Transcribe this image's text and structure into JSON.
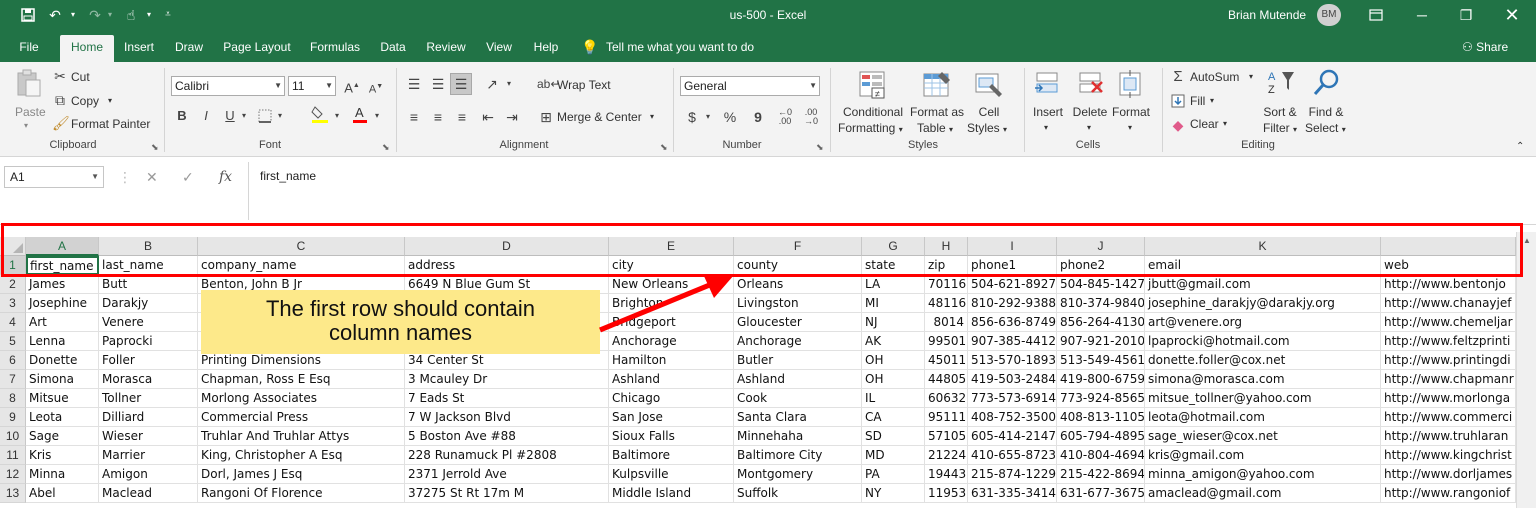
{
  "window": {
    "title": "us-500  -  Excel",
    "user": "Brian Mutende",
    "initials": "BM"
  },
  "tabs": [
    "File",
    "Home",
    "Insert",
    "Draw",
    "Page Layout",
    "Formulas",
    "Data",
    "Review",
    "View",
    "Help"
  ],
  "tell_me": "Tell me what you want to do",
  "share": "Share",
  "ribbon": {
    "clipboard": {
      "paste": "Paste",
      "cut": "Cut",
      "copy": "Copy",
      "format_painter": "Format Painter",
      "label": "Clipboard"
    },
    "font": {
      "name": "Calibri",
      "size": "11",
      "label": "Font",
      "bold": "B",
      "italic": "I",
      "underline": "U",
      "grow": "A",
      "shrink": "A"
    },
    "alignment": {
      "wrap_text": "Wrap Text",
      "merge_center": "Merge & Center",
      "label": "Alignment"
    },
    "number": {
      "format": "General",
      "currency": "$",
      "percent": "%",
      "comma": "9",
      "label": "Number"
    },
    "styles": {
      "conditional": "Conditional",
      "formatting": "Formatting",
      "format_as": "Format as",
      "table": "Table",
      "cell": "Cell",
      "styles": "Styles",
      "label": "Styles"
    },
    "cells": {
      "insert": "Insert",
      "delete": "Delete",
      "format": "Format",
      "label": "Cells"
    },
    "editing": {
      "autosum": "AutoSum",
      "fill": "Fill",
      "clear": "Clear",
      "sort": "Sort &",
      "filter": "Filter",
      "find": "Find &",
      "select": "Select",
      "label": "Editing"
    }
  },
  "formula_bar": {
    "name_box": "A1",
    "fx": "fx",
    "content": "first_name"
  },
  "columns": [
    "A",
    "B",
    "C",
    "D",
    "E",
    "F",
    "G",
    "H",
    "I",
    "J",
    "K",
    ""
  ],
  "rows": [
    {
      "n": "1",
      "cells": [
        "first_name",
        "last_name",
        "company_name",
        "address",
        "city",
        "county",
        "state",
        "zip",
        "phone1",
        "phone2",
        "email",
        "web"
      ]
    },
    {
      "n": "2",
      "cells": [
        "James",
        "Butt",
        "Benton, John B Jr",
        "6649 N Blue Gum St",
        "New Orleans",
        "Orleans",
        "LA",
        "70116",
        "504-621-8927",
        "504-845-1427",
        "jbutt@gmail.com",
        "http://www.bentonjo"
      ]
    },
    {
      "n": "3",
      "cells": [
        "Josephine",
        "Darakjy",
        "",
        "",
        "Brighton",
        "Livingston",
        "MI",
        "48116",
        "810-292-9388",
        "810-374-9840",
        "josephine_darakjy@darakjy.org",
        "http://www.chanayjef"
      ]
    },
    {
      "n": "4",
      "cells": [
        "Art",
        "Venere",
        "",
        "",
        "Bridgeport",
        "Gloucester",
        "NJ",
        "8014",
        "856-636-8749",
        "856-264-4130",
        "art@venere.org",
        "http://www.chemeljar"
      ]
    },
    {
      "n": "5",
      "cells": [
        "Lenna",
        "Paprocki",
        "",
        "",
        "Anchorage",
        "Anchorage",
        "AK",
        "99501",
        "907-385-4412",
        "907-921-2010",
        "lpaprocki@hotmail.com",
        "http://www.feltzprinti"
      ]
    },
    {
      "n": "6",
      "cells": [
        "Donette",
        "Foller",
        "Printing Dimensions",
        "34 Center St",
        "Hamilton",
        "Butler",
        "OH",
        "45011",
        "513-570-1893",
        "513-549-4561",
        "donette.foller@cox.net",
        "http://www.printingdi"
      ]
    },
    {
      "n": "7",
      "cells": [
        "Simona",
        "Morasca",
        "Chapman, Ross E Esq",
        "3 Mcauley Dr",
        "Ashland",
        "Ashland",
        "OH",
        "44805",
        "419-503-2484",
        "419-800-6759",
        "simona@morasca.com",
        "http://www.chapmanr"
      ]
    },
    {
      "n": "8",
      "cells": [
        "Mitsue",
        "Tollner",
        "Morlong Associates",
        "7 Eads St",
        "Chicago",
        "Cook",
        "IL",
        "60632",
        "773-573-6914",
        "773-924-8565",
        "mitsue_tollner@yahoo.com",
        "http://www.morlonga"
      ]
    },
    {
      "n": "9",
      "cells": [
        "Leota",
        "Dilliard",
        "Commercial Press",
        "7 W Jackson Blvd",
        "San Jose",
        "Santa Clara",
        "CA",
        "95111",
        "408-752-3500",
        "408-813-1105",
        "leota@hotmail.com",
        "http://www.commerci"
      ]
    },
    {
      "n": "10",
      "cells": [
        "Sage",
        "Wieser",
        "Truhlar And Truhlar Attys",
        "5 Boston Ave #88",
        "Sioux Falls",
        "Minnehaha",
        "SD",
        "57105",
        "605-414-2147",
        "605-794-4895",
        "sage_wieser@cox.net",
        "http://www.truhlaran"
      ]
    },
    {
      "n": "11",
      "cells": [
        "Kris",
        "Marrier",
        "King, Christopher A Esq",
        "228 Runamuck Pl #2808",
        "Baltimore",
        "Baltimore City",
        "MD",
        "21224",
        "410-655-8723",
        "410-804-4694",
        "kris@gmail.com",
        "http://www.kingchrist"
      ]
    },
    {
      "n": "12",
      "cells": [
        "Minna",
        "Amigon",
        "Dorl, James J Esq",
        "2371 Jerrold Ave",
        "Kulpsville",
        "Montgomery",
        "PA",
        "19443",
        "215-874-1229",
        "215-422-8694",
        "minna_amigon@yahoo.com",
        "http://www.dorljames"
      ]
    },
    {
      "n": "13",
      "cells": [
        "Abel",
        "Maclead",
        "Rangoni Of Florence",
        "37275 St  Rt 17m M",
        "Middle Island",
        "Suffolk",
        "NY",
        "11953",
        "631-335-3414",
        "631-677-3675",
        "amaclead@gmail.com",
        "http://www.rangoniof"
      ]
    }
  ],
  "callout": {
    "line1": "The first row should contain",
    "line2": "column names"
  },
  "colors": {
    "excel_green": "#217346",
    "highlight": "#ff0000",
    "callout_bg": "#fde98a"
  }
}
